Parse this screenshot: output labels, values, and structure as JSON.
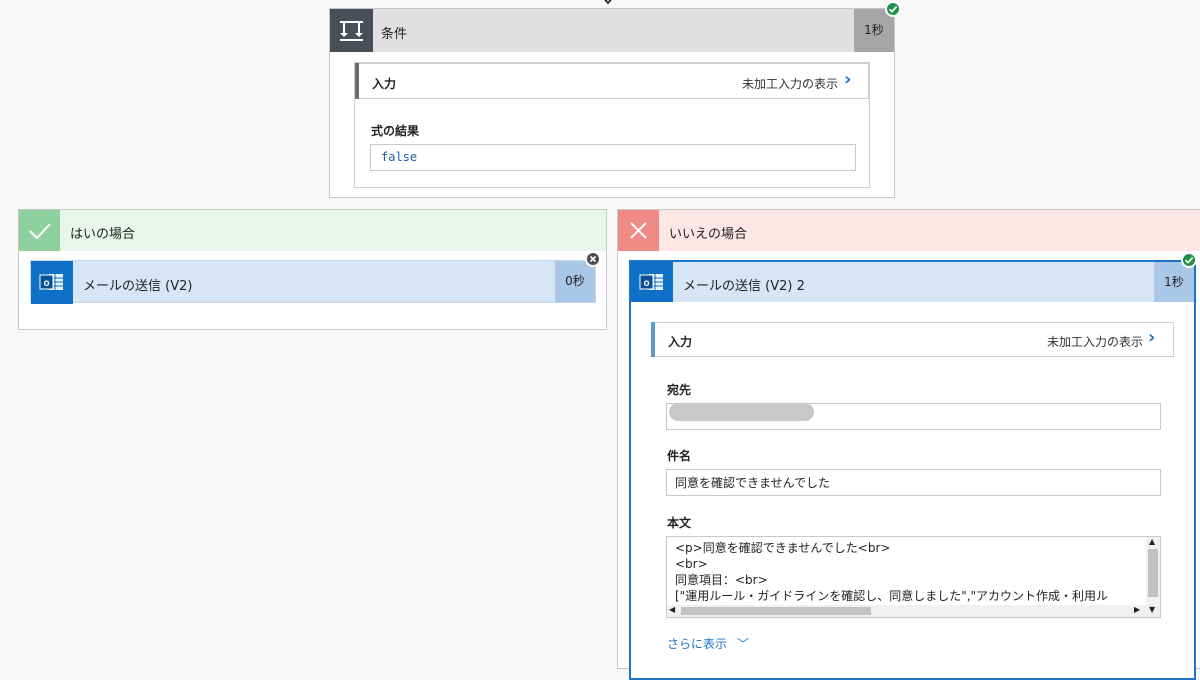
{
  "condition": {
    "title": "条件",
    "duration": "1秒",
    "input_label": "入力",
    "raw_link": "未加工入力の表示",
    "result_label": "式の結果",
    "result_value": "false"
  },
  "yes_branch": {
    "title": "はいの場合",
    "action_title": "メールの送信 (V2)",
    "action_duration": "0秒"
  },
  "no_branch": {
    "title": "いいえの場合",
    "action_title": "メールの送信 (V2) 2",
    "action_duration": "1秒",
    "input_label": "入力",
    "raw_link": "未加工入力の表示",
    "to_label": "宛先",
    "subject_label": "件名",
    "subject_value": "同意を確認できませんでした",
    "body_label": "本文",
    "body_lines": [
      "<p>同意を確認できませんでした<br>",
      "<br>",
      "同意項目：<br>",
      "[\"運用ルール・ガイドラインを確認し、同意しました\",\"アカウント作成・利用ル"
    ],
    "show_more": "さらに表示"
  },
  "colors": {
    "accent_blue": "#1f74c7",
    "success_green": "#1d9146",
    "yes_green": "#8fd19e",
    "no_red": "#f08a84"
  }
}
